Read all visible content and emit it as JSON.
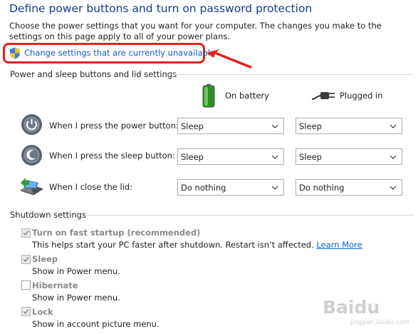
{
  "header": {
    "title": "Define power buttons and turn on password protection",
    "intro": "Choose the power settings that you want for your computer. The changes you make to the settings on this page apply to all of your power plans."
  },
  "change_link": {
    "label": "Change settings that are currently unavailable",
    "icon": "uac-shield-icon"
  },
  "power_section": {
    "title": "Power and sleep buttons and lid settings",
    "columns": [
      {
        "label": "On battery",
        "icon": "battery-icon"
      },
      {
        "label": "Plugged in",
        "icon": "power-plug-icon"
      }
    ],
    "rows": [
      {
        "label": "When I press the power button:",
        "icon": "power-button-icon",
        "battery": "Sleep",
        "plugged": "Sleep"
      },
      {
        "label": "When I press the sleep button:",
        "icon": "sleep-button-icon",
        "battery": "Sleep",
        "plugged": "Sleep"
      },
      {
        "label": "When I close the lid:",
        "icon": "laptop-lid-icon",
        "battery": "Do nothing",
        "plugged": "Do nothing"
      }
    ]
  },
  "shutdown_section": {
    "title": "Shutdown settings",
    "items": [
      {
        "label": "Turn on fast startup (recommended)",
        "checked": true,
        "desc": "This helps start your PC faster after shutdown. Restart isn’t affected.",
        "link": "Learn More"
      },
      {
        "label": "Sleep",
        "checked": true,
        "desc": "Show in Power menu."
      },
      {
        "label": "Hibernate",
        "checked": false,
        "desc": "Show in Power menu."
      },
      {
        "label": "Lock",
        "checked": true,
        "desc": "Show in account picture menu."
      }
    ]
  },
  "colors": {
    "title": "#163a8f",
    "link": "#0b5fc6",
    "highlight": "#e0241c",
    "disabled_text": "#8a8a8a"
  },
  "watermark": {
    "text": "Baidu",
    "sub": "jingyan.baidu.com"
  }
}
